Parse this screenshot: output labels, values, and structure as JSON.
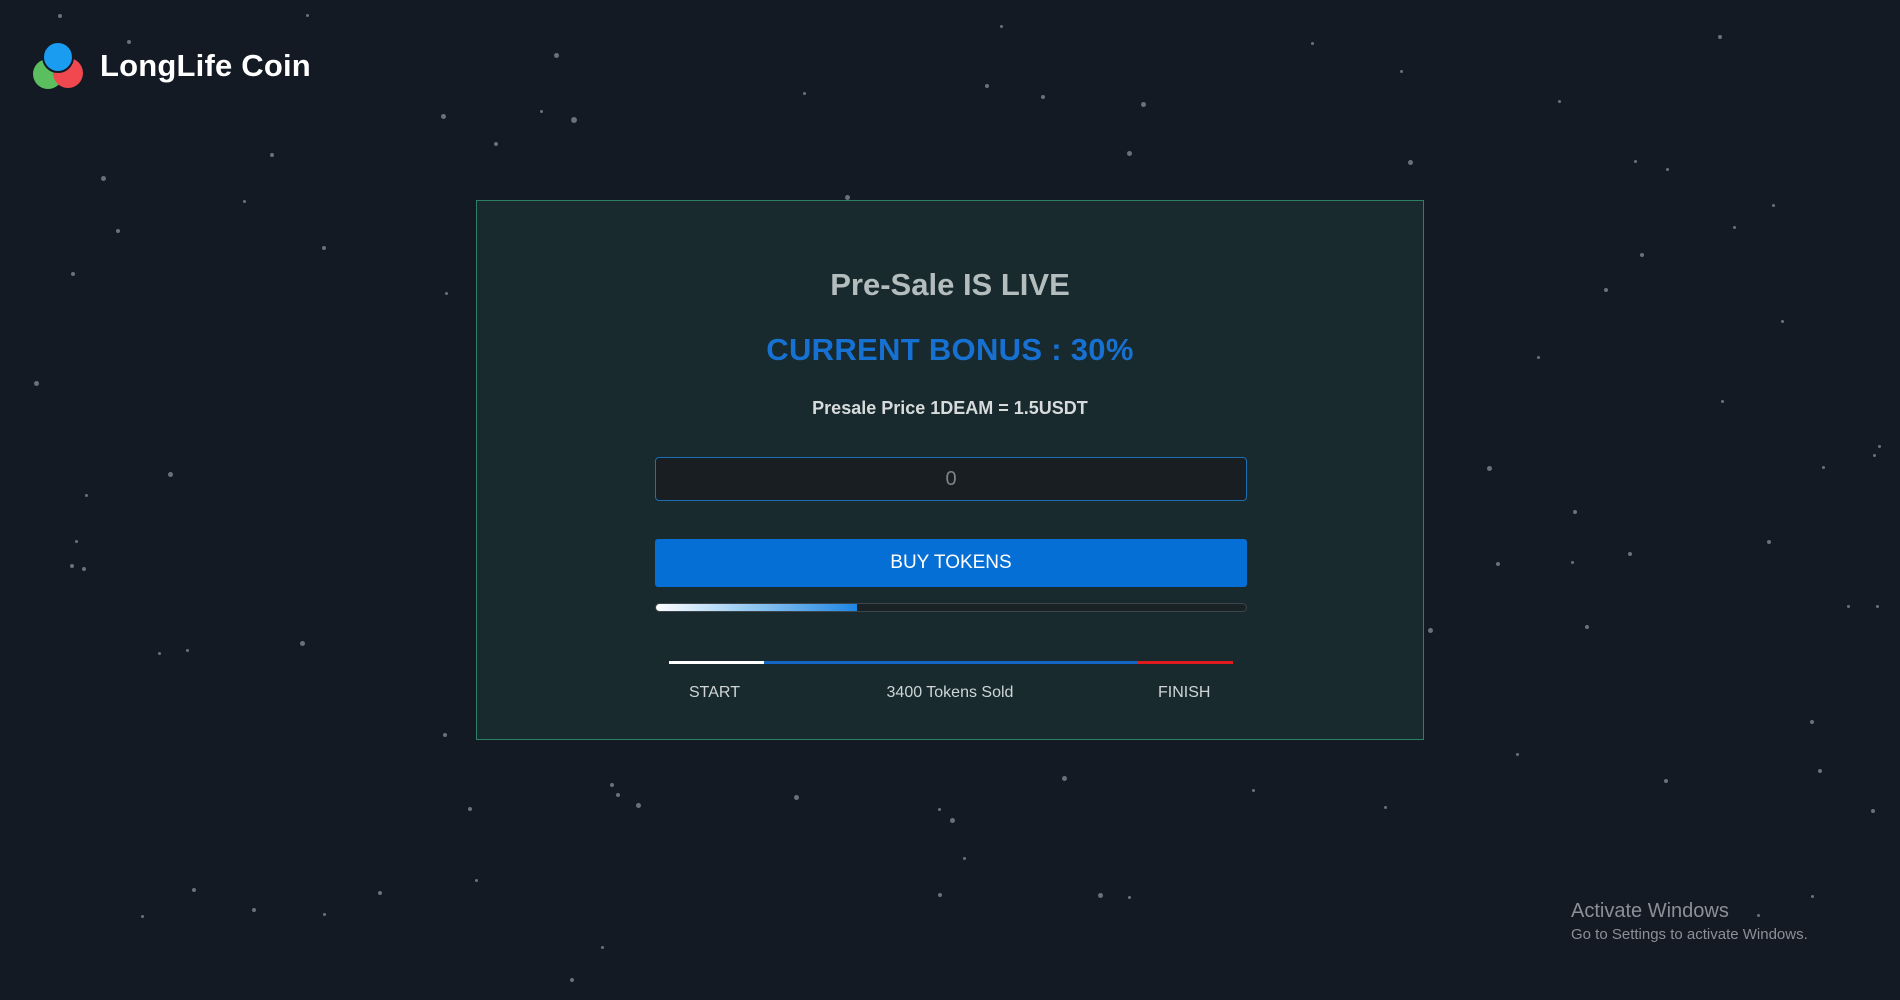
{
  "header": {
    "brand": "LongLife Coin",
    "logo_icon": "three-circles-logo-icon"
  },
  "presale": {
    "title": "Pre-Sale IS LIVE",
    "bonus": "CURRENT BONUS : 30%",
    "price": "Presale Price 1DEAM = 1.5USDT",
    "amount_value": "",
    "amount_placeholder": "0",
    "buy_label": "BUY TOKENS",
    "progress_fraction": 0.34,
    "start_label": "START",
    "sold_label": "3400 Tokens Sold",
    "finish_label": "FINISH"
  },
  "watermark": {
    "title": "Activate Windows",
    "subtitle": "Go to Settings to activate Windows."
  },
  "colors": {
    "background": "#131a23",
    "card": "#182a2e",
    "card_border": "#2f7f66",
    "accent": "#056fd6",
    "bonus_text": "#1671d3",
    "finish_red": "#e01b20"
  }
}
